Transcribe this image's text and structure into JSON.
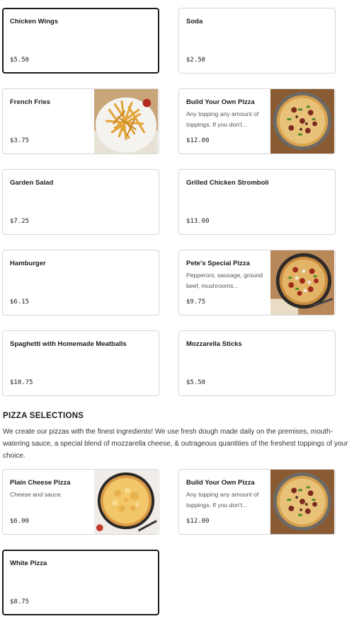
{
  "menu_items": [
    {
      "name": "Chicken Wings",
      "price": "$5.50"
    },
    {
      "name": "Soda",
      "price": "$2.50"
    },
    {
      "name": "French Fries",
      "price": "$3.75"
    },
    {
      "name": "Build Your Own Pizza",
      "desc": "Any topping any amount of toppings. If you don't...",
      "price": "$12.00"
    },
    {
      "name": "Garden Salad",
      "price": "$7.25"
    },
    {
      "name": "Grilled Chicken Stromboli",
      "price": "$13.00"
    },
    {
      "name": "Hamburger",
      "price": "$6.15"
    },
    {
      "name": "Pete's Special Pizza",
      "desc": "Pepperoni, sausage, ground beef, mushrooms...",
      "price": "$9.75"
    },
    {
      "name": "Spaghetti with Homemade Meatballs",
      "price": "$10.75"
    },
    {
      "name": "Mozzarella Sticks",
      "price": "$5.50"
    }
  ],
  "pizza_section": {
    "title": "PIZZA SELECTIONS",
    "description": "We create our pizzas with the finest ingredients! We use fresh dough made daily on the premises, mouth-watering sauce, a special blend of mozzarella cheese, & outrageous quantities of the freshest toppings of your choice.",
    "items": [
      {
        "name": "Plain Cheese Pizza",
        "desc": "Cheese and sauce.",
        "price": "$6.00"
      },
      {
        "name": "Build Your Own Pizza",
        "desc": "Any topping any amount of toppings. If you don't...",
        "price": "$12.00"
      },
      {
        "name": "White Pizza",
        "price": "$8.75"
      }
    ]
  },
  "image_names": [
    "french-fries-photo",
    "pizza-photo",
    "cheese-pizza-photo"
  ]
}
